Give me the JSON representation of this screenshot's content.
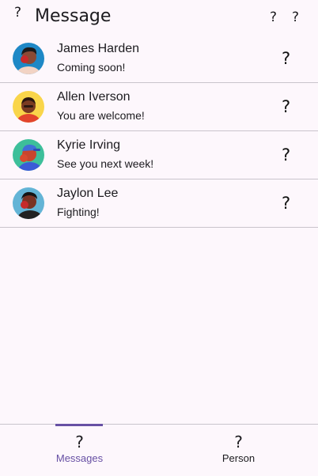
{
  "appbar": {
    "leading_icon": "?",
    "title": "Message",
    "action_icon_1": "?",
    "action_icon_2": "?"
  },
  "contacts": [
    {
      "name": "James Harden",
      "message": "Coming soon!",
      "trailing_icon": "?",
      "avatar_bg": "#1e88c6"
    },
    {
      "name": "Allen Iverson",
      "message": "You are welcome!",
      "trailing_icon": "?",
      "avatar_bg": "#f9d54a"
    },
    {
      "name": "Kyrie Irving",
      "message": "See you next week!",
      "trailing_icon": "?",
      "avatar_bg": "#3dbf9a"
    },
    {
      "name": "Jaylon Lee",
      "message": "Fighting!",
      "trailing_icon": "?",
      "avatar_bg": "#63b4d6"
    }
  ],
  "bottom_nav": {
    "items": [
      {
        "icon": "?",
        "label": "Messages",
        "selected": true
      },
      {
        "icon": "?",
        "label": "Person",
        "selected": false
      }
    ]
  },
  "colors": {
    "background": "#fdf7fc",
    "accent": "#6750a4",
    "divider": "#c9c4cc"
  }
}
